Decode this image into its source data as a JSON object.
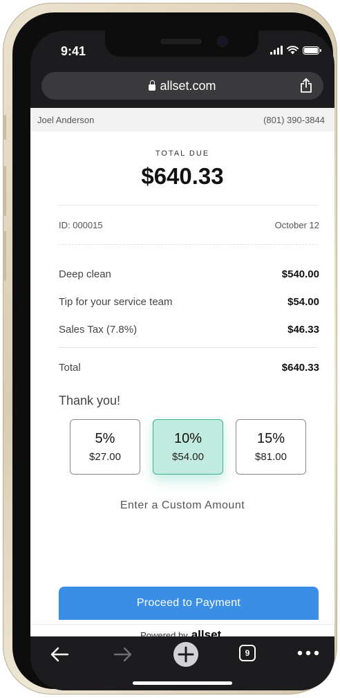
{
  "status": {
    "time": "9:41"
  },
  "browser": {
    "url": "allset.com",
    "tab_count": "9"
  },
  "customer": {
    "name": "Joel Anderson",
    "phone": "(801) 390-3844"
  },
  "invoice": {
    "total_due_label": "TOTAL DUE",
    "total_due_amount": "$640.33",
    "id": "ID: 000015",
    "date": "October 12",
    "line_items": [
      {
        "label": "Deep clean",
        "amount": "$540.00"
      },
      {
        "label": "Tip for your service team",
        "amount": "$54.00"
      },
      {
        "label": "Sales Tax (7.8%)",
        "amount": "$46.33"
      }
    ],
    "total_label": "Total",
    "total_amount": "$640.33"
  },
  "tips": {
    "thanks": "Thank you!",
    "options": [
      {
        "percent": "5%",
        "amount": "$27.00"
      },
      {
        "percent": "10%",
        "amount": "$54.00"
      },
      {
        "percent": "15%",
        "amount": "$81.00"
      }
    ],
    "selected_index": 1,
    "custom_label": "Enter a Custom Amount"
  },
  "actions": {
    "proceed_label": "Proceed to Payment"
  },
  "footer": {
    "powered_by": "Powered by",
    "brand": "allset."
  },
  "colors": {
    "accent": "#3b8ee6",
    "tip_selected_bg": "#c2ebdf",
    "tip_selected_border": "#3bb08f"
  },
  "icons": [
    "lock-icon",
    "share-icon",
    "back-icon",
    "forward-icon",
    "new-tab-icon",
    "tabs-icon",
    "more-icon"
  ]
}
